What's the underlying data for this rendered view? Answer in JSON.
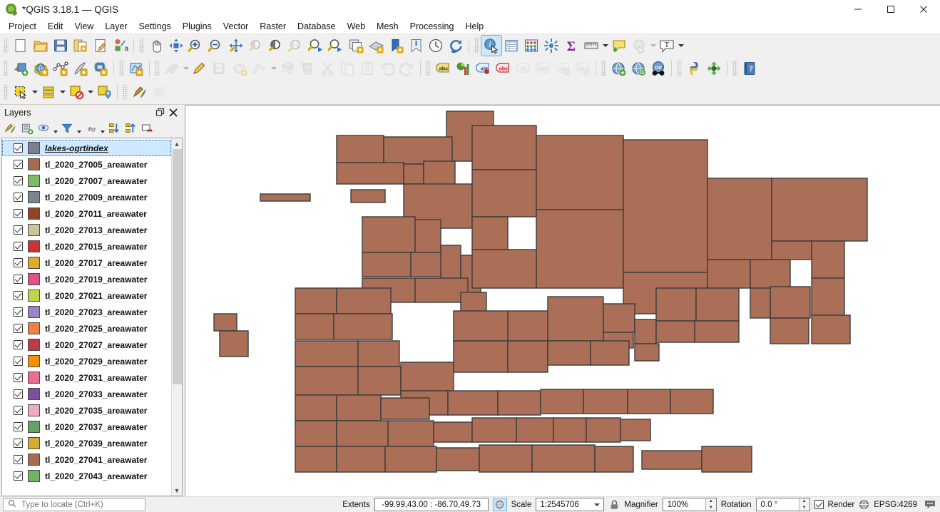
{
  "window": {
    "title": "*QGIS 3.18.1 — QGIS",
    "logo_icon": "qgis-logo-icon",
    "minimize_label": "—",
    "maximize_label": "❐",
    "close_label": "✕"
  },
  "menubar": {
    "items": [
      {
        "label": "Project"
      },
      {
        "label": "Edit"
      },
      {
        "label": "View"
      },
      {
        "label": "Layer"
      },
      {
        "label": "Settings"
      },
      {
        "label": "Plugins"
      },
      {
        "label": "Vector"
      },
      {
        "label": "Raster"
      },
      {
        "label": "Database"
      },
      {
        "label": "Web"
      },
      {
        "label": "Mesh"
      },
      {
        "label": "Processing"
      },
      {
        "label": "Help"
      }
    ]
  },
  "toolbars": {
    "row1": [
      {
        "icon": "new-project-icon",
        "title": "New Project"
      },
      {
        "icon": "open-project-icon",
        "title": "Open Project"
      },
      {
        "icon": "save-project-icon",
        "title": "Save Project"
      },
      {
        "icon": "save-project-as-icon",
        "title": "Save Project As"
      },
      {
        "icon": "new-print-layout-icon",
        "title": "New Print Layout"
      },
      {
        "icon": "style-manager-icon",
        "title": "Style Manager"
      },
      {
        "sep": true
      },
      {
        "icon": "pan-map-icon",
        "title": "Pan Map"
      },
      {
        "icon": "pan-to-selection-icon",
        "title": "Pan Map to Selection"
      },
      {
        "icon": "zoom-in-icon",
        "title": "Zoom In"
      },
      {
        "icon": "zoom-out-icon",
        "title": "Zoom Out"
      },
      {
        "icon": "zoom-full-icon",
        "title": "Zoom Full"
      },
      {
        "icon": "zoom-selection-icon",
        "title": "Zoom to Selection",
        "disabled": true
      },
      {
        "icon": "zoom-layer-icon",
        "title": "Zoom to Layer"
      },
      {
        "icon": "zoom-native-icon",
        "title": "Zoom to Native Resolution",
        "disabled": true
      },
      {
        "icon": "zoom-last-icon",
        "title": "Zoom Last"
      },
      {
        "icon": "zoom-next-icon",
        "title": "Zoom Next"
      },
      {
        "icon": "new-map-view-icon",
        "title": "New Map View"
      },
      {
        "icon": "new-3d-map-view-icon",
        "title": "New 3D Map View"
      },
      {
        "icon": "show-bookmarks-icon",
        "title": "Show Spatial Bookmarks"
      },
      {
        "icon": "new-bookmark-icon",
        "title": "New Spatial Bookmark"
      },
      {
        "icon": "temporal-controller-icon",
        "title": "Temporal Controller Panel"
      },
      {
        "icon": "refresh-icon",
        "title": "Refresh"
      },
      {
        "sep": true
      },
      {
        "icon": "identify-features-icon",
        "title": "Identify Features",
        "active": true
      },
      {
        "icon": "open-attribute-table-icon",
        "title": "Open Attribute Table"
      },
      {
        "icon": "statistical-summary-icon",
        "title": "Statistical Summary"
      },
      {
        "icon": "field-calculator-icon",
        "title": "Field Calculator"
      },
      {
        "icon": "sum-icon",
        "title": "Show Statistical Summary"
      },
      {
        "icon": "measure-line-icon",
        "title": "Measure Line",
        "caret": true
      },
      {
        "icon": "map-tips-icon",
        "title": "Show Map Tips"
      },
      {
        "icon": "deselect-features-icon",
        "title": "Deselect Features",
        "disabled": true,
        "caret": true
      },
      {
        "icon": "text-annotation-icon",
        "title": "Text Annotation",
        "caret": true
      }
    ],
    "row2": [
      {
        "icon": "add-vector-layer-icon",
        "title": "Add Vector Layer"
      },
      {
        "icon": "add-raster-layer-icon",
        "title": "Add Raster Layer"
      },
      {
        "icon": "add-delimited-text-layer-icon",
        "title": "Add Delimited Text Layer"
      },
      {
        "icon": "add-spatialite-layer-icon",
        "title": "Add SpatiaLite Layer"
      },
      {
        "icon": "add-postgis-layer-icon",
        "title": "Add PostGIS Layer"
      },
      {
        "sep": true
      },
      {
        "icon": "new-shapefile-layer-icon",
        "title": "New Shapefile Layer"
      },
      {
        "sep": true
      },
      {
        "icon": "current-edits-icon",
        "title": "Current Edits",
        "disabled": true,
        "caret": true
      },
      {
        "icon": "toggle-editing-icon",
        "title": "Toggle Editing"
      },
      {
        "icon": "save-layer-edits-icon",
        "title": "Save Layer Edits",
        "disabled": true
      },
      {
        "icon": "add-feature-icon",
        "title": "Add Feature",
        "disabled": true
      },
      {
        "icon": "vertex-tool-icon",
        "title": "Vertex Tool",
        "disabled": true,
        "caret": true
      },
      {
        "icon": "modify-attributes-icon",
        "title": "Modify Attributes of Features",
        "disabled": true
      },
      {
        "icon": "delete-selected-icon",
        "title": "Delete Selected",
        "disabled": true
      },
      {
        "icon": "cut-features-icon",
        "title": "Cut Features",
        "disabled": true
      },
      {
        "icon": "copy-features-icon",
        "title": "Copy Features",
        "disabled": true
      },
      {
        "icon": "paste-features-icon",
        "title": "Paste Features",
        "disabled": true
      },
      {
        "icon": "undo-icon",
        "title": "Undo",
        "disabled": true
      },
      {
        "icon": "redo-icon",
        "title": "Redo",
        "disabled": true
      },
      {
        "sep": true
      },
      {
        "icon": "label-abc-icon",
        "title": "Layer Labeling Options"
      },
      {
        "icon": "diagram-icon",
        "title": "Layer Diagram Options"
      },
      {
        "icon": "highlight-pinned-labels-icon",
        "title": "Highlight Pinned Labels"
      },
      {
        "icon": "pin-labels-icon",
        "title": "Pin/Unpin Labels"
      },
      {
        "icon": "show-hide-labels-icon",
        "title": "Show/Hide Labels",
        "disabled": true
      },
      {
        "icon": "move-label-icon",
        "title": "Move Label",
        "disabled": true
      },
      {
        "icon": "rotate-label-icon",
        "title": "Rotate Label",
        "disabled": true
      },
      {
        "icon": "change-label-icon",
        "title": "Change Label",
        "disabled": true
      },
      {
        "sep": true
      },
      {
        "icon": "metasearch-icon",
        "title": "MetaSearch"
      },
      {
        "icon": "wms-layer-icon",
        "title": "Add WMS Layer"
      },
      {
        "icon": "geocoding-icon",
        "title": "Geocoding"
      },
      {
        "sep": true
      },
      {
        "icon": "python-console-icon",
        "title": "Python Console"
      },
      {
        "icon": "plugin-manager-icon",
        "title": "Plugin Manager"
      },
      {
        "sep": true
      },
      {
        "icon": "help-icon",
        "title": "Help Contents"
      }
    ],
    "row3": [
      {
        "icon": "select-features-icon",
        "title": "Select Features by Area",
        "caret": true
      },
      {
        "icon": "select-by-expression-icon",
        "title": "Select Features by Value",
        "caret": true
      },
      {
        "icon": "deselect-all-icon",
        "title": "Deselect Features from All Layers",
        "caret": true
      },
      {
        "icon": "select-by-location-icon",
        "title": "Select by Location"
      },
      {
        "sep": true
      },
      {
        "icon": "processing-toolbox-icon",
        "title": "Toolbox"
      },
      {
        "icon": "model-designer-icon",
        "title": "Graphical Modeler",
        "disabled": true
      }
    ]
  },
  "panel": {
    "title": "Layers",
    "undock_icon": "undock-icon",
    "close_icon": "close-icon",
    "toolbar": [
      {
        "icon": "open-layer-styling-icon",
        "title": "Open the Layer Styling panel"
      },
      {
        "icon": "add-group-icon",
        "title": "Add Group"
      },
      {
        "icon": "manage-visibility-icon",
        "title": "Manage Map Themes",
        "caret": true
      },
      {
        "icon": "filter-legend-icon",
        "title": "Filter Legend",
        "caret": true
      },
      {
        "icon": "expression-filter-icon",
        "title": "Filter Legend by Expression",
        "caret": true
      },
      {
        "icon": "expand-all-icon",
        "title": "Expand All"
      },
      {
        "icon": "collapse-all-icon",
        "title": "Collapse All"
      },
      {
        "icon": "remove-layer-icon",
        "title": "Remove Layer/Group"
      }
    ],
    "layers": [
      {
        "name": "lakes-ogrtindex",
        "color": "#7b808f",
        "checked": true,
        "selected": true
      },
      {
        "name": "tl_2020_27005_areawater",
        "color": "#a96a52",
        "checked": true,
        "selected": false
      },
      {
        "name": "tl_2020_27007_areawater",
        "color": "#7fba67",
        "checked": true,
        "selected": false
      },
      {
        "name": "tl_2020_27009_areawater",
        "color": "#76878f",
        "checked": true,
        "selected": false
      },
      {
        "name": "tl_2020_27011_areawater",
        "color": "#8e4723",
        "checked": true,
        "selected": false
      },
      {
        "name": "tl_2020_27013_areawater",
        "color": "#cfc39c",
        "checked": true,
        "selected": false
      },
      {
        "name": "tl_2020_27015_areawater",
        "color": "#cc3338",
        "checked": true,
        "selected": false
      },
      {
        "name": "tl_2020_27017_areawater",
        "color": "#e0aa2e",
        "checked": true,
        "selected": false
      },
      {
        "name": "tl_2020_27019_areawater",
        "color": "#e15287",
        "checked": true,
        "selected": false
      },
      {
        "name": "tl_2020_27021_areawater",
        "color": "#bcd44b",
        "checked": true,
        "selected": false
      },
      {
        "name": "tl_2020_27023_areawater",
        "color": "#9f83c9",
        "checked": true,
        "selected": false
      },
      {
        "name": "tl_2020_27025_areawater",
        "color": "#ef7f45",
        "checked": true,
        "selected": false
      },
      {
        "name": "tl_2020_27027_areawater",
        "color": "#bc3b45",
        "checked": true,
        "selected": false
      },
      {
        "name": "tl_2020_27029_areawater",
        "color": "#f79007",
        "checked": true,
        "selected": false
      },
      {
        "name": "tl_2020_27031_areawater",
        "color": "#ea6e93",
        "checked": true,
        "selected": false
      },
      {
        "name": "tl_2020_27033_areawater",
        "color": "#7c4fa0",
        "checked": true,
        "selected": false
      },
      {
        "name": "tl_2020_27035_areawater",
        "color": "#f1a9bd",
        "checked": true,
        "selected": false
      },
      {
        "name": "tl_2020_27037_areawater",
        "color": "#68a167",
        "checked": true,
        "selected": false
      },
      {
        "name": "tl_2020_27039_areawater",
        "color": "#d4ac35",
        "checked": true,
        "selected": false
      },
      {
        "name": "tl_2020_27041_areawater",
        "color": "#a96a52",
        "checked": true,
        "selected": false
      },
      {
        "name": "tl_2020_27043_areawater",
        "color": "#72b263",
        "checked": true,
        "selected": false
      }
    ]
  },
  "map": {
    "background": "#ffffff",
    "fill": "#ab6f57",
    "stroke": "#3c3c3c"
  },
  "statusbar": {
    "locate_placeholder": "Type to locate (Ctrl+K)",
    "locate_icon": "search-icon",
    "extents_label": "Extents",
    "extents_value": "-99.99,43.00 : -86.70,49.73",
    "extents_toggle_icon": "toggle-extents-icon",
    "scale_label": "Scale",
    "scale_value": "1:2545706",
    "lock_icon": "lock-scale-icon",
    "magnifier_label": "Magnifier",
    "magnifier_value": "100%",
    "rotation_label": "Rotation",
    "rotation_value": "0.0 °",
    "render_label": "Render",
    "render_checked": true,
    "crs_icon": "crs-globe-icon",
    "crs_label": "EPSG:4269",
    "messages_icon": "messages-icon"
  }
}
